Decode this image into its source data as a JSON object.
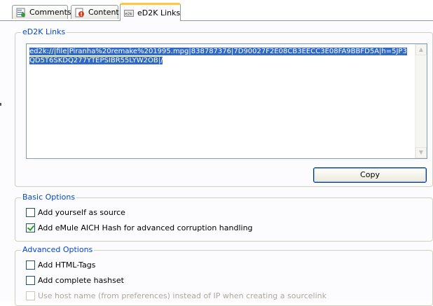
{
  "tabs": [
    {
      "label": "Comments",
      "icon": "comments-icon"
    },
    {
      "label": "Content",
      "icon": "content-icon"
    },
    {
      "label": "eD2K Links",
      "icon": "ed2k-icon",
      "active": true
    }
  ],
  "ed2k_group": {
    "title": "eD2K Links",
    "link_text": "ed2k://|file|Piranha%20remake%201995.mpg|838787376|7D90027F2E08CB3EECC3E08FA9BBFD5A|h=5JP3QD5T6SKDQ277YTEPSIBR55LYW2OB|/",
    "copy_label": "Copy"
  },
  "basic_options": {
    "title": "Basic Options",
    "items": [
      {
        "label": "Add yourself as source",
        "checked": false,
        "enabled": true
      },
      {
        "label": "Add eMule AICH Hash for advanced corruption handling",
        "checked": true,
        "enabled": true
      }
    ]
  },
  "advanced_options": {
    "title": "Advanced Options",
    "items": [
      {
        "label": "Add HTML-Tags",
        "checked": false,
        "enabled": true
      },
      {
        "label": "Add complete hashset",
        "checked": false,
        "enabled": true
      },
      {
        "label": "Use host name (from preferences) instead of IP when creating a sourcelink",
        "checked": false,
        "enabled": false
      }
    ]
  },
  "colors": {
    "group_title": "#0046d5",
    "active_tab_accent": "#ffc83c",
    "selection": "#316ac5"
  }
}
